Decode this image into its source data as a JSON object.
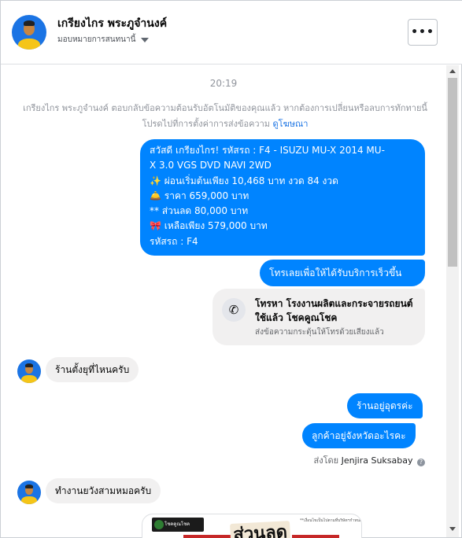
{
  "header": {
    "contact_name": "เกรียงไกร พระภูจำนงค์",
    "assign_label": "มอบหมายการสนทนานี้",
    "more_label": "•••"
  },
  "thread": {
    "time": "20:19",
    "notice_text": "เกรียงไกร พระภูจำนงค์ ตอบกลับข้อความต้อนรับอัตโนมัติของคุณแล้ว หากต้องการเปลี่ยนหรือลบการทักทายนี้ โปรดไปที่การตั้งค่าการส่งข้อความ",
    "notice_link": "ดูโฆษณา",
    "offer_lines": [
      "สวัสดี เกรียงไกร!  รหัสรถ : F4 - ISUZU MU-X 2014 MU-",
      "X 3.0 VGS DVD NAVI 2WD",
      "✨ ผ่อนเริ่มต้นเพียง 10,468 บาท งวด 84 งวด",
      "🛎️ ราคา 659,000 บาท",
      "** ส่วนลด 80,000 บาท",
      "🎀 เหลือเพียง 579,000 บาท",
      " รหัสรถ : F4"
    ],
    "call_prompt": "โทรเลยเพื่อให้ได้รับบริการเร็วขึ้น",
    "call_card": {
      "title": "โทรหา โรงงานผลิตและกระจายรถยนต์ใช้แล้ว โชคคูณโชค",
      "subtitle": "ส่งข้อความกระตุ้นให้โทรด้วยเสียงแล้ว"
    },
    "customer_q1": "ร้านตั้งยุที่ไหนครับ",
    "reply_1": "ร้านอยู่อุดรค่ะ",
    "reply_2": "ลูกค้าอยู่จังหวัดอะไรคะ",
    "sent_by_prefix": "ส่งโดย",
    "sent_by_name": "Jenjira Suksabay",
    "customer_q2": "ทำงานยวังสามหมอครับ",
    "image_preview": {
      "logo_text": "โชคคูณโชค",
      "fine_print": "**เงื่อนไขเป็นไปตามที่บริษัทฯกำหนด**",
      "sticker_text": "ส่วนลด"
    }
  },
  "colors": {
    "outgoing_bubble": "#0084ff",
    "incoming_bubble": "#f1f0f0",
    "link": "#1b74e4"
  }
}
